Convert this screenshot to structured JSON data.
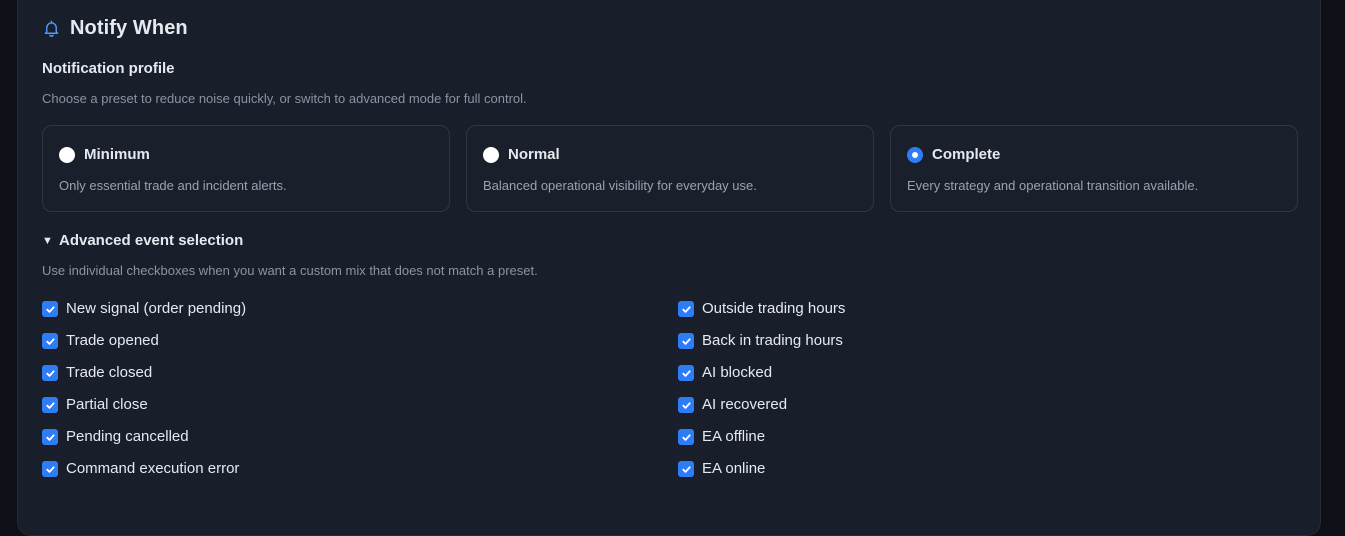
{
  "header": {
    "title": "Notify When",
    "icon": "bell-icon"
  },
  "profile_section": {
    "label": "Notification profile",
    "hint": "Choose a preset to reduce noise quickly, or switch to advanced mode for full control.",
    "selected": "Complete",
    "options": [
      {
        "name": "Minimum",
        "description": "Only essential trade and incident alerts."
      },
      {
        "name": "Normal",
        "description": "Balanced operational visibility for everyday use."
      },
      {
        "name": "Complete",
        "description": "Every strategy and operational transition available."
      }
    ]
  },
  "advanced": {
    "label": "Advanced event selection",
    "expanded": true,
    "hint": "Use individual checkboxes when you want a custom mix that does not match a preset.",
    "left_events": [
      {
        "label": "New signal (order pending)",
        "checked": true
      },
      {
        "label": "Trade opened",
        "checked": true
      },
      {
        "label": "Trade closed",
        "checked": true
      },
      {
        "label": "Partial close",
        "checked": true
      },
      {
        "label": "Pending cancelled",
        "checked": true
      },
      {
        "label": "Command execution error",
        "checked": true
      }
    ],
    "right_events": [
      {
        "label": "Outside trading hours",
        "checked": true
      },
      {
        "label": "Back in trading hours",
        "checked": true
      },
      {
        "label": "AI blocked",
        "checked": true
      },
      {
        "label": "AI recovered",
        "checked": true
      },
      {
        "label": "EA offline",
        "checked": true
      },
      {
        "label": "EA online",
        "checked": true
      }
    ]
  },
  "colors": {
    "accent": "#2f7df6",
    "card_bg": "#191e2b",
    "page_bg": "#0d1117",
    "text_primary": "#e6e9ef",
    "text_muted": "#8b93a4"
  }
}
